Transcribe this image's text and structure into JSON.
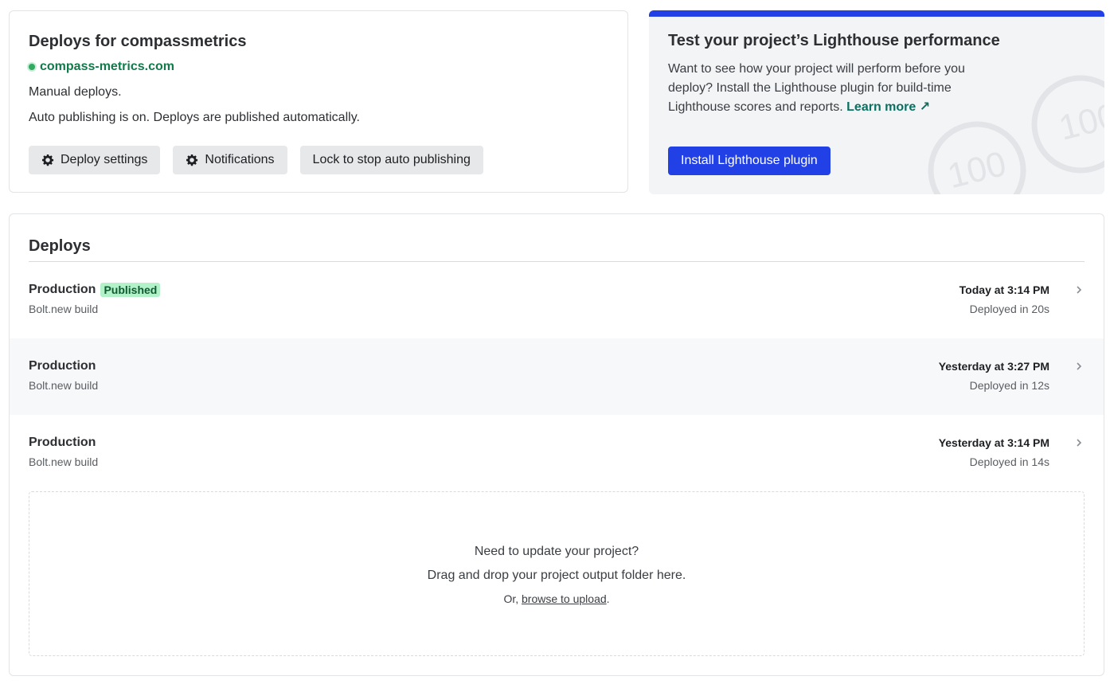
{
  "deploy_card": {
    "title": "Deploys for compassmetrics",
    "site_url": "compass-metrics.com",
    "deploy_mode": "Manual deploys.",
    "auto_publish_status": "Auto publishing is on. Deploys are published automatically.",
    "buttons": {
      "deploy_settings": "Deploy settings",
      "notifications": "Notifications",
      "lock": "Lock to stop auto publishing"
    }
  },
  "lighthouse_card": {
    "title": "Test your project’s Lighthouse performance",
    "description": "Want to see how your project will perform before you deploy? Install the Lighthouse plugin for build-time Lighthouse scores and reports.",
    "learn_more": "Learn more",
    "learn_more_icon": "external-arrow-icon",
    "button": "Install Lighthouse plugin",
    "score_graphic_value": "100",
    "accent_color": "#2140e6"
  },
  "deploys": {
    "title": "Deploys",
    "rows": [
      {
        "context": "Production",
        "badge": "Published",
        "source": "Bolt.new build",
        "time": "Today at 3:14 PM",
        "duration": "Deployed in 20s"
      },
      {
        "context": "Production",
        "badge": "",
        "source": "Bolt.new build",
        "time": "Yesterday at 3:27 PM",
        "duration": "Deployed in 12s"
      },
      {
        "context": "Production",
        "badge": "",
        "source": "Bolt.new build",
        "time": "Yesterday at 3:14 PM",
        "duration": "Deployed in 14s"
      }
    ]
  },
  "dropzone": {
    "line1": "Need to update your project?",
    "line2": "Drag and drop your project output folder here.",
    "prefix": "Or,",
    "link": "browse to upload",
    "suffix": "."
  }
}
